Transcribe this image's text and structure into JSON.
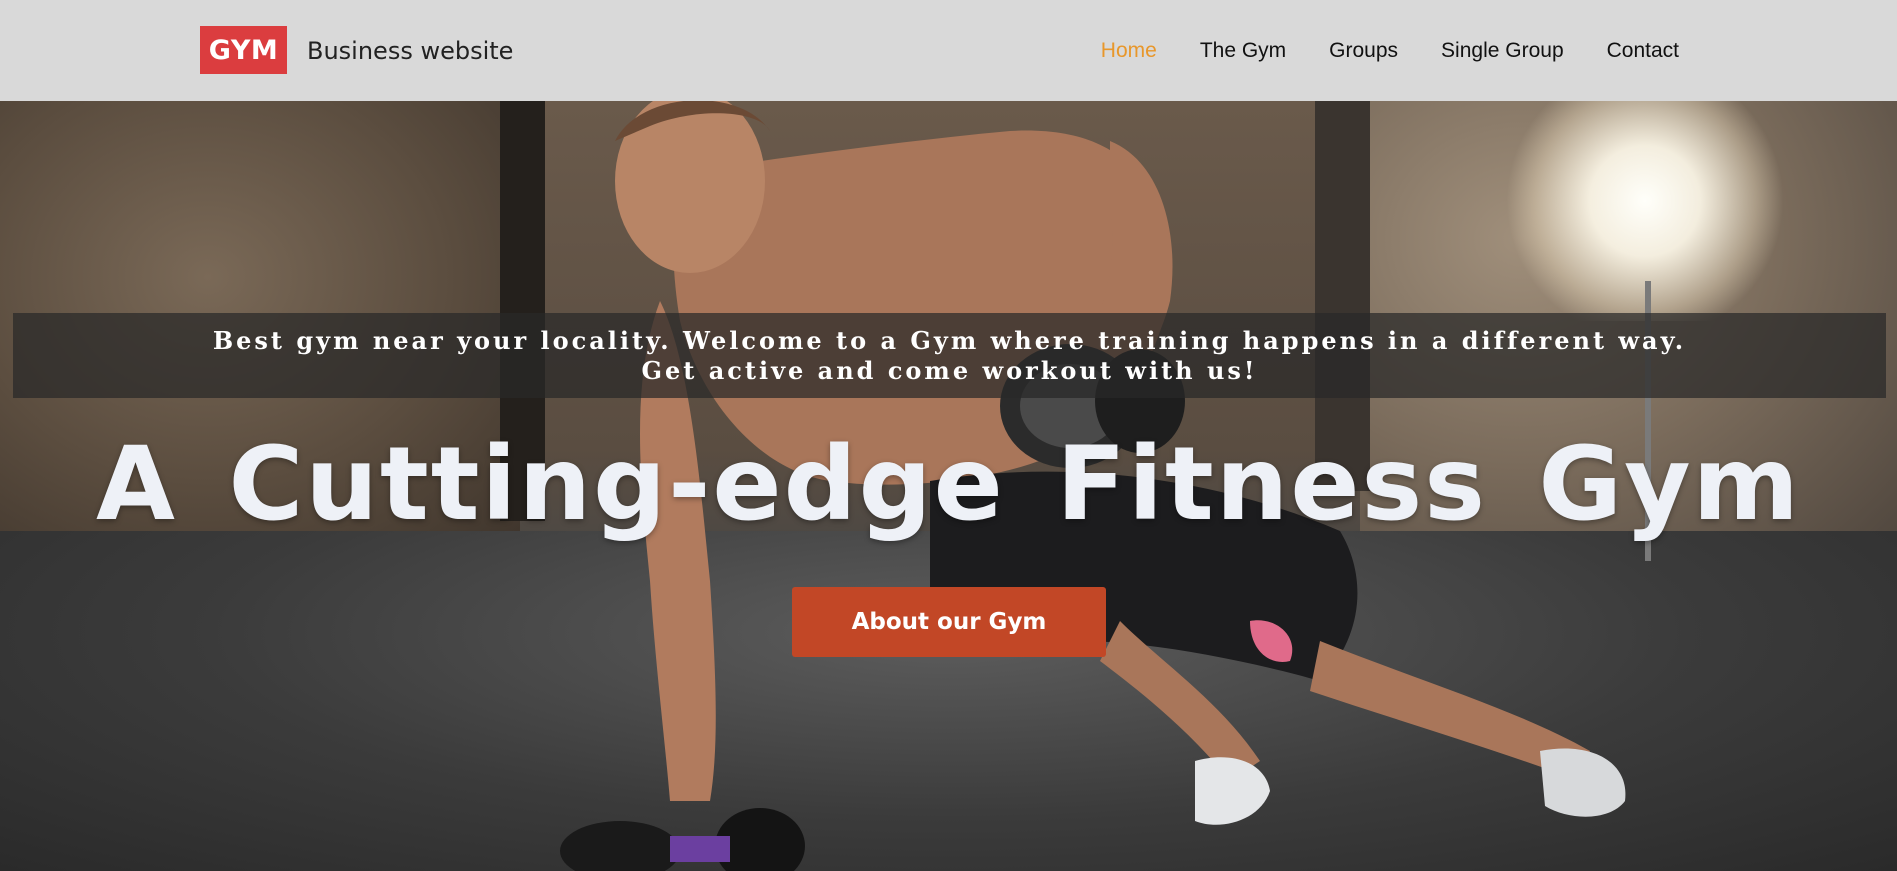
{
  "header": {
    "logo_text": "GYM",
    "site_name": "Business website",
    "nav": [
      {
        "label": "Home",
        "active": true
      },
      {
        "label": "The Gym",
        "active": false
      },
      {
        "label": "Groups",
        "active": false
      },
      {
        "label": "Single Group",
        "active": false
      },
      {
        "label": "Contact",
        "active": false
      }
    ]
  },
  "hero": {
    "tagline_line1": "Best gym near your locality. Welcome to a Gym where training happens in a different way.",
    "tagline_line2": "Get active and come workout with us!",
    "title": "A Cutting-edge Fitness Gym",
    "cta_label": "About our Gym"
  },
  "colors": {
    "header_bg": "#d9d9d9",
    "logo_bg": "#db3d3f",
    "nav_active": "#e8972b",
    "cta_bg": "#c24726"
  },
  "icons": [
    "gym-logo-badge"
  ]
}
